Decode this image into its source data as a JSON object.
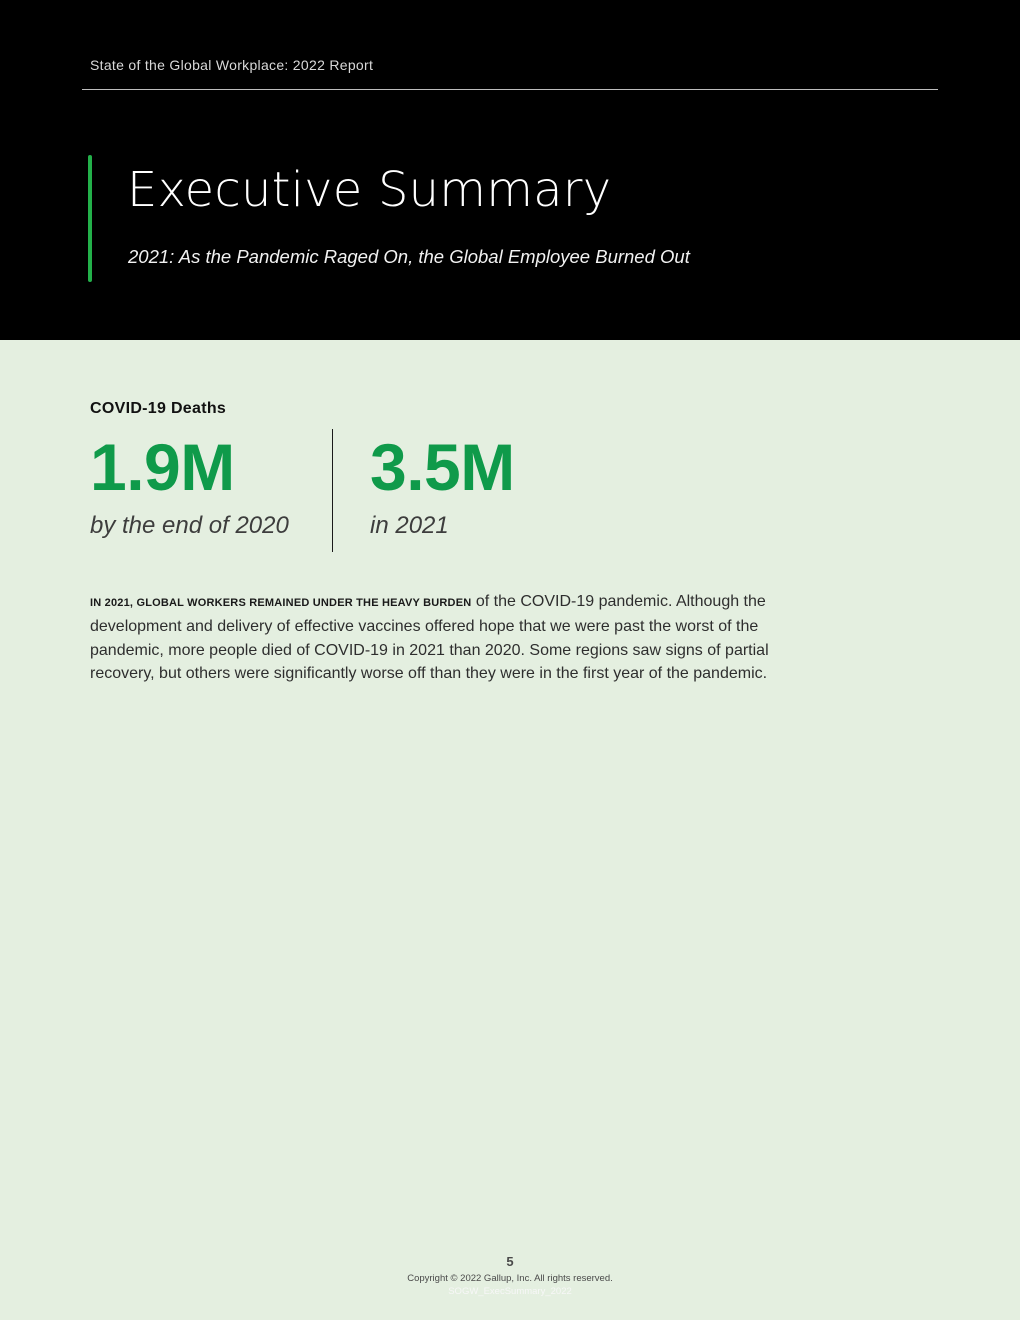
{
  "header": {
    "running_head": "State of the Global Workplace: 2022 Report",
    "title": "Executive Summary",
    "subtitle": "2021: As the Pandemic Raged On, the Global Employee Burned Out"
  },
  "stats": {
    "heading": "COVID-19 Deaths",
    "items": [
      {
        "value": "1.9M",
        "label": "by the end of 2020"
      },
      {
        "value": "3.5M",
        "label": "in 2021"
      }
    ]
  },
  "body": {
    "lead_in": "IN 2021, GLOBAL WORKERS REMAINED UNDER THE HEAVY BURDEN",
    "text": "of the COVID-19 pandemic. Although the development and delivery of effective vaccines offered hope that we were past the worst of the pandemic, more people died of COVID-19 in 2021 than 2020. Some regions saw signs of partial recovery, but others were significantly worse off than they were in the first year of the pandemic."
  },
  "footer": {
    "page_number": "5",
    "copyright": "Copyright © 2022 Gallup, Inc. All rights reserved.",
    "doc_code": "SOGW_ExecSummary_2022"
  },
  "colors": {
    "hero_background": "#000000",
    "page_background": "#e4efe0",
    "accent_green": "#23b04a",
    "stat_green": "#0f9a4a"
  }
}
